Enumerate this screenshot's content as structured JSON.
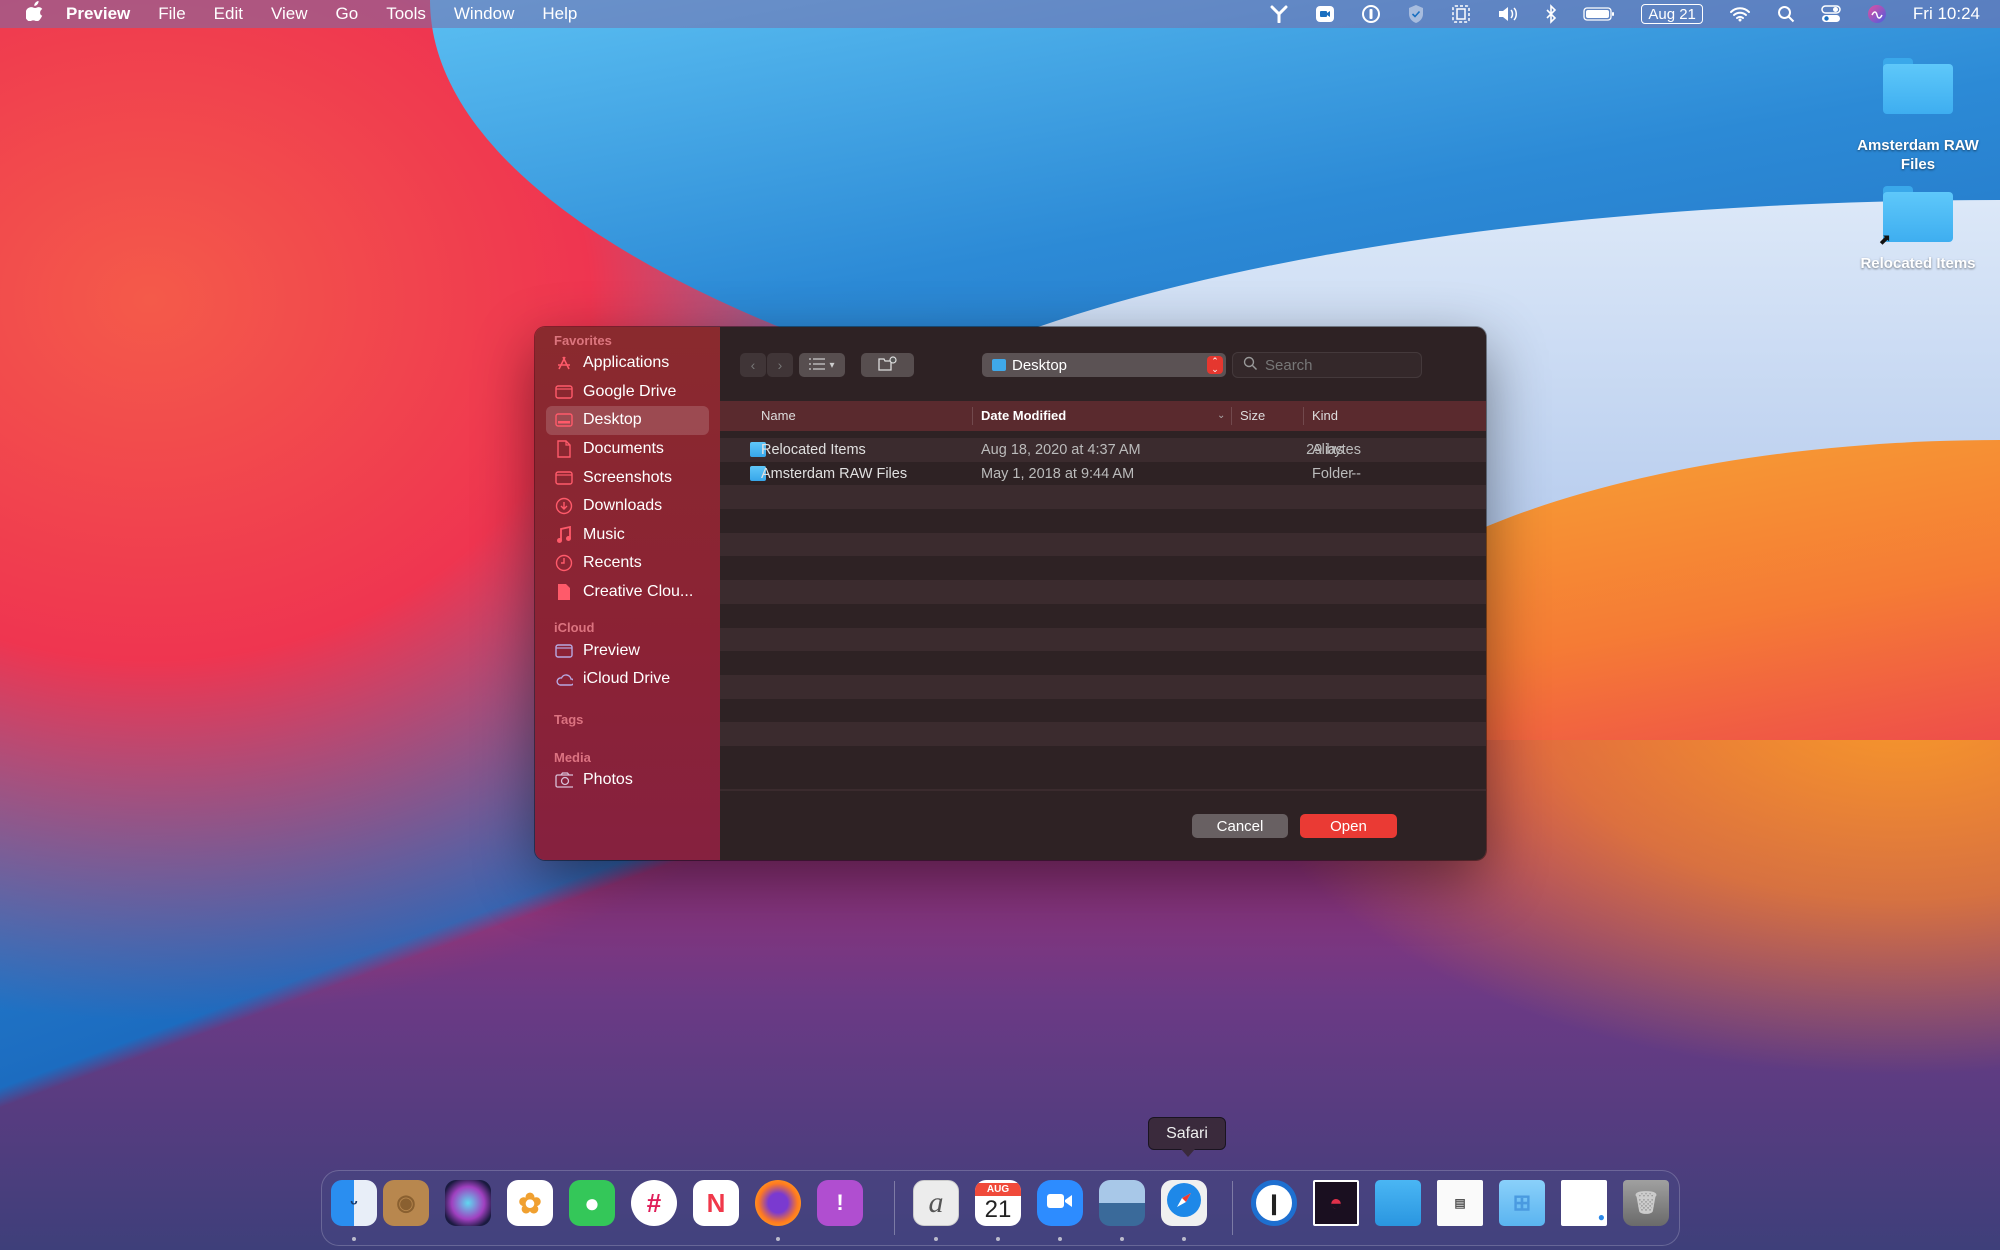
{
  "menubar": {
    "apple_icon": "apple-logo",
    "app_name": "Preview",
    "menus": [
      "File",
      "Edit",
      "View",
      "Go",
      "Tools",
      "Window",
      "Help"
    ],
    "status_icons": [
      "yubikey-icon",
      "zoom-icon",
      "1password-icon",
      "shield-icon",
      "screenshot-icon",
      "volume-icon",
      "bluetooth-icon",
      "battery-icon"
    ],
    "date_badge": "Aug 21",
    "clock": "Fri 10:24"
  },
  "desktop": {
    "icons": [
      {
        "label": "Amsterdam RAW Files",
        "type": "folder"
      },
      {
        "label": "Relocated Items",
        "type": "alias-folder"
      }
    ]
  },
  "dialog": {
    "sidebar": {
      "sections": [
        {
          "title": "Favorites",
          "items": [
            {
              "label": "Applications",
              "icon": "applications-icon"
            },
            {
              "label": "Google Drive",
              "icon": "folder-icon"
            },
            {
              "label": "Desktop",
              "icon": "desktop-icon",
              "selected": true
            },
            {
              "label": "Documents",
              "icon": "document-icon"
            },
            {
              "label": "Screenshots",
              "icon": "folder-icon"
            },
            {
              "label": "Downloads",
              "icon": "downloads-icon"
            },
            {
              "label": "Music",
              "icon": "music-icon"
            },
            {
              "label": "Recents",
              "icon": "clock-icon"
            },
            {
              "label": "Creative Clou...",
              "icon": "file-icon"
            }
          ]
        },
        {
          "title": "iCloud",
          "items": [
            {
              "label": "Preview",
              "icon": "folder-icon"
            },
            {
              "label": "iCloud Drive",
              "icon": "cloud-icon"
            }
          ]
        },
        {
          "title": "Tags",
          "items": []
        },
        {
          "title": "Media",
          "items": [
            {
              "label": "Photos",
              "icon": "camera-icon"
            }
          ]
        }
      ]
    },
    "toolbar": {
      "location": "Desktop",
      "search_placeholder": "Search"
    },
    "columns": {
      "name": "Name",
      "date_modified": "Date Modified",
      "size": "Size",
      "kind": "Kind"
    },
    "files": [
      {
        "name": "Relocated Items",
        "date": "Aug 18, 2020 at 4:37 AM",
        "size": "29 bytes",
        "kind": "Alias"
      },
      {
        "name": "Amsterdam RAW Files",
        "date": "May 1, 2018 at 9:44 AM",
        "size": "--",
        "kind": "Folder"
      }
    ],
    "buttons": {
      "cancel": "Cancel",
      "open": "Open"
    }
  },
  "dock": {
    "tooltip": "Safari",
    "apps": [
      {
        "name": "Finder",
        "running": true
      },
      {
        "name": "Contacts",
        "running": false
      },
      {
        "name": "Siri",
        "running": false
      },
      {
        "name": "Photos",
        "running": false
      },
      {
        "name": "Messages",
        "running": false
      },
      {
        "name": "Slack",
        "running": false
      },
      {
        "name": "News",
        "running": false
      },
      {
        "name": "Firefox",
        "running": true
      },
      {
        "name": "Feedback Assistant",
        "running": false
      },
      {
        "name": "Script Editor",
        "running": true
      },
      {
        "name": "Calendar",
        "running": true,
        "month": "AUG",
        "day": "21"
      },
      {
        "name": "Zoom",
        "running": true
      },
      {
        "name": "Preview",
        "running": true
      },
      {
        "name": "Safari",
        "running": true
      },
      {
        "name": "1Password",
        "running": false
      },
      {
        "name": "Screen Recording Folder",
        "running": false
      },
      {
        "name": "Folder",
        "running": false
      },
      {
        "name": "Document Stack",
        "running": false
      },
      {
        "name": "Windows Folder",
        "running": false
      },
      {
        "name": "Safari Window",
        "running": false
      },
      {
        "name": "Trash",
        "running": false
      }
    ]
  }
}
